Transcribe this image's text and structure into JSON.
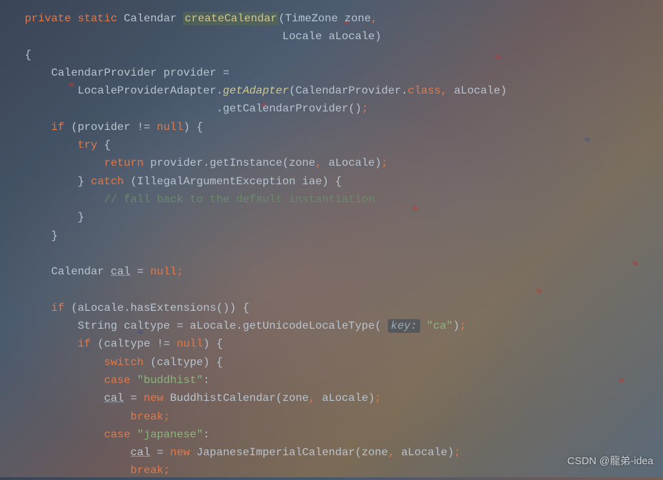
{
  "code": {
    "line1": {
      "private": "private",
      "static": "static",
      "ret": "Calendar",
      "method": "createCalendar",
      "p1t": "TimeZone",
      "p1n": "zone",
      "comma": ","
    },
    "line2": {
      "p2t": "Locale",
      "p2n": "aLocale",
      "close": ")"
    },
    "line3": {
      "brace": "{"
    },
    "line4": {
      "t": "CalendarProvider provider ="
    },
    "line5": {
      "pre": "LocaleProviderAdapter.",
      "get": "getAdapter",
      "args1": "(CalendarProvider.",
      "cls": "class",
      "comma": ",",
      "arg2": " aLocale)"
    },
    "line6": {
      "t": ".getCalendarProvider()",
      "semi": ";"
    },
    "line7": {
      "if": "if",
      "open": " (provider != ",
      "null": "null",
      "close": ") {"
    },
    "line8": {
      "try": "try",
      "brace": " {"
    },
    "line9": {
      "ret": "return",
      "expr": " provider.getInstance(zone",
      "comma": ",",
      "arg": " aLocale)",
      "semi": ";"
    },
    "line10": {
      "close": "} ",
      "catch": "catch",
      "rest": " (IllegalArgumentException iae) {"
    },
    "line11": {
      "comment": "// fall back to the default instantiation"
    },
    "line12": {
      "t": "}"
    },
    "line13": {
      "t": "}"
    },
    "line15": {
      "type": "Calendar ",
      "var": "cal",
      "eq": " = ",
      "null": "null",
      "semi": ";"
    },
    "line17": {
      "if": "if",
      "cond": " (aLocale.hasExtensions()) {"
    },
    "line18": {
      "pre": "String caltype = aLocale.getUnicodeLocaleType( ",
      "hint": "key:",
      "str": "\"ca\"",
      "close": ")",
      "semi": ";"
    },
    "line19": {
      "if": "if",
      "open": " (caltype != ",
      "null": "null",
      "close": ") {"
    },
    "line20": {
      "switch": "switch",
      "cond": " (caltype) {"
    },
    "line21": {
      "case": "case",
      "str": "\"buddhist\"",
      "colon": ":"
    },
    "line22": {
      "var": "cal",
      "eq": " = ",
      "new": "new",
      "expr": " BuddhistCalendar(zone",
      "comma": ",",
      "arg": " aLocale)",
      "semi": ";"
    },
    "line23": {
      "break": "break",
      "semi": ";"
    },
    "line24": {
      "case": "case",
      "str": "\"japanese\"",
      "colon": ":"
    },
    "line25": {
      "var": "cal",
      "eq": " = ",
      "new": "new",
      "expr": " JapaneseImperialCalendar(zone",
      "comma": ",",
      "arg": " aLocale)",
      "semi": ";"
    },
    "line26": {
      "break": "break",
      "semi": ";"
    }
  },
  "watermark": "CSDN @龍弟-idea"
}
